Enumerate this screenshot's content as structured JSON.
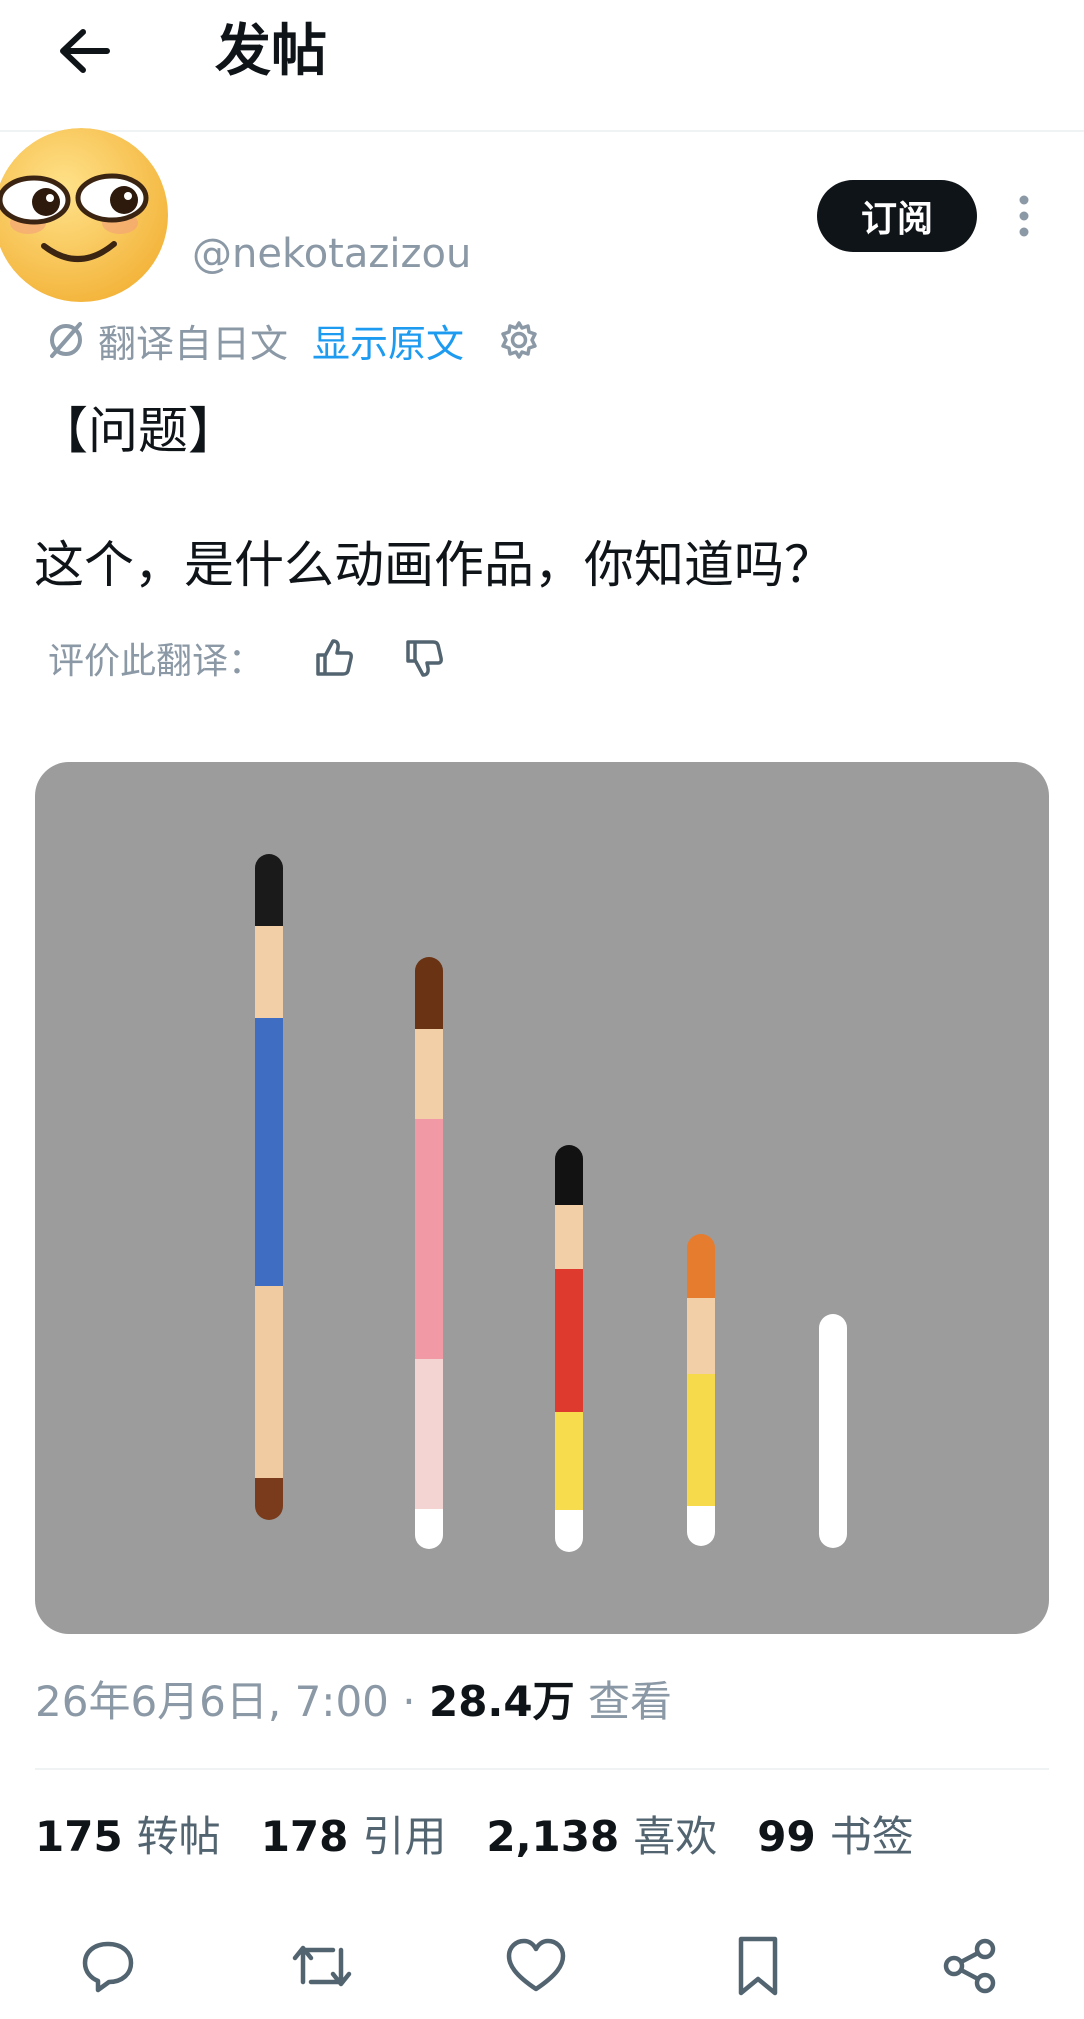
{
  "header": {
    "back_icon": "arrow-left-icon",
    "title": "发帖"
  },
  "author": {
    "name": "",
    "handle": "@nekotazizou",
    "subscribe_label": "订阅",
    "more_icon": "more-vertical-icon",
    "avatar_icon": "emoji-face-icon"
  },
  "translation": {
    "label": "翻译自日文",
    "show_original": "显示原文",
    "settings_icon": "gear-icon",
    "icon": "translate-icon"
  },
  "post": {
    "line1": "【问题】",
    "line2": "这个，是什么动画作品，你知道吗？"
  },
  "rate": {
    "label": "评价此翻译：",
    "up_icon": "thumbs-up-icon",
    "down_icon": "thumbs-down-icon"
  },
  "media": {
    "background": "#9c9c9c",
    "stick_colors": [
      [
        "#1a1a1a",
        "#f2cfa6",
        "#3e6dc1",
        "#f0caa0",
        "#7a3b1c"
      ],
      [
        "#6a3314",
        "#f2cfa6",
        "#f19aa5",
        "#f4d3d3",
        "#ffffff"
      ],
      [
        "#121212",
        "#f2cfa6",
        "#df3a2e",
        "#f7dc4d",
        "#ffffff"
      ],
      [
        "#e67c2e",
        "#f2cfa6",
        "#f7d94c",
        "#ffffff"
      ],
      [
        "#ffffff"
      ]
    ]
  },
  "meta": {
    "date": "26年6月6日, 7:00",
    "separator": " · ",
    "views_count": "28.4万",
    "views_label": "查看"
  },
  "stats": [
    {
      "num": "175",
      "label": "转帖"
    },
    {
      "num": "178",
      "label": "引用"
    },
    {
      "num": "2,138",
      "label": "喜欢"
    },
    {
      "num": "99",
      "label": "书签"
    }
  ],
  "actions": [
    "reply-icon",
    "retweet-icon",
    "like-icon",
    "bookmark-icon",
    "share-icon"
  ],
  "colors": {
    "accent": "#1d9bf0",
    "text": "#0f1419",
    "muted": "#8b98a5",
    "button_bg": "#0f1419"
  }
}
